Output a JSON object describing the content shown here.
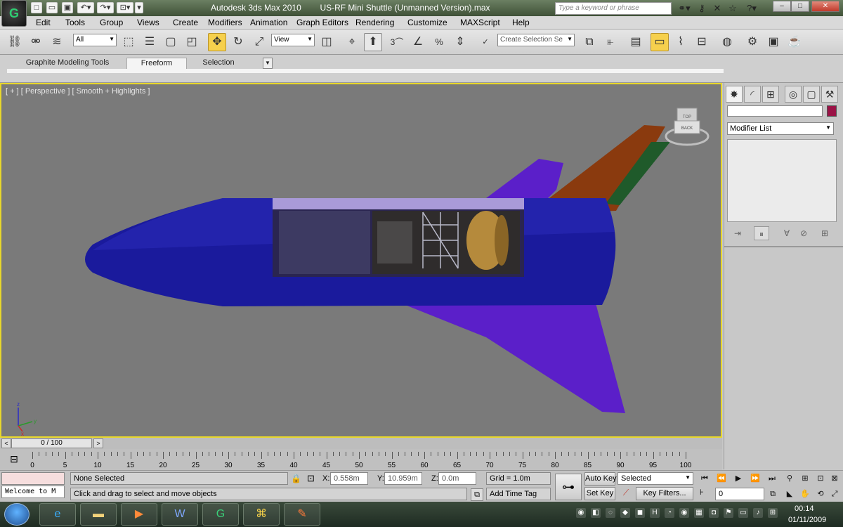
{
  "window": {
    "app_title": "Autodesk 3ds Max  2010",
    "file_title": "US-RF Mini Shuttle (Unmanned Version).max",
    "search_placeholder": "Type a keyword or phrase"
  },
  "menu": [
    "Edit",
    "Tools",
    "Group",
    "Views",
    "Create",
    "Modifiers",
    "Animation",
    "Graph Editors",
    "Rendering",
    "Customize",
    "MAXScript",
    "Help"
  ],
  "toolbar": {
    "selection_filter": "All",
    "reference_coord": "View",
    "snap_label": "3",
    "named_selection_placeholder": "Create Selection Se"
  },
  "ribbon": {
    "tabs": [
      "Graphite Modeling Tools",
      "Freeform",
      "Selection"
    ],
    "active_tab": "Freeform"
  },
  "viewport": {
    "label": "[ + ] [ Perspective ] [ Smooth + Highlights ]",
    "axis": {
      "z": "z",
      "x": "x",
      "y": "y"
    },
    "viewcube_label": "BACK",
    "viewcube_top": "TOP"
  },
  "command_panel": {
    "modifier_list": "Modifier List",
    "object_color": "#9a1346"
  },
  "timeline": {
    "frame_display": "0 / 100",
    "ticks": [
      0,
      5,
      10,
      15,
      20,
      25,
      30,
      35,
      40,
      45,
      50,
      55,
      60,
      65,
      70,
      75,
      80,
      85,
      90,
      95,
      100
    ]
  },
  "status": {
    "maxscript_listener": "Welcome to M",
    "selection": "None Selected",
    "prompt": "Click and drag to select and move objects",
    "x_label": "X:",
    "x_value": "0.558m",
    "y_label": "Y:",
    "y_value": "10.959m",
    "z_label": "Z:",
    "z_value": "0.0m",
    "grid": "Grid = 1.0m",
    "add_time_tag": "Add Time Tag",
    "auto_key": "Auto Key",
    "set_key": "Set Key",
    "key_mode": "Selected",
    "key_filters": "Key Filters...",
    "current_frame": "0"
  },
  "taskbar": {
    "time": "00:14",
    "date": "01/11/2009"
  },
  "colors": {
    "viewport_bg": "#7a7a7a",
    "viewport_border": "#e8d72b",
    "shuttle_body": "#1a1a9c",
    "shuttle_wing": "#5b1fc9",
    "tail_orange": "#8a3a0e",
    "tail_green": "#1f5a2a",
    "active_tool": "#f6d04d"
  }
}
